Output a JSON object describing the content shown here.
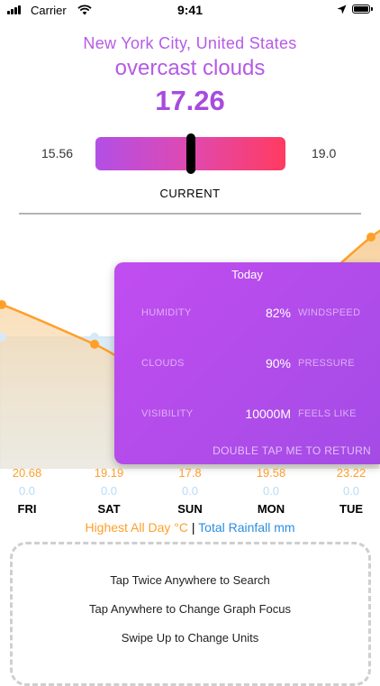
{
  "status_bar": {
    "carrier": "Carrier",
    "time": "9:41"
  },
  "location": {
    "city": "New York City, United States"
  },
  "weather": {
    "description": "overcast clouds",
    "temperature": "17.26"
  },
  "gauge": {
    "min": "15.56",
    "max": "19.0",
    "label": "CURRENT",
    "current_fraction": 0.5
  },
  "details_card": {
    "title": "Today",
    "humidity_label": "HUMIDITY",
    "humidity_value": "82%",
    "windspeed_label": "WINDSPEED",
    "clouds_label": "CLOUDS",
    "clouds_value": "90%",
    "pressure_label": "PRESSURE",
    "visibility_label": "VISIBILITY",
    "visibility_value": "10000M",
    "feels_like_label": "FEELS LIKE",
    "return_hint": "DOUBLE TAP ME TO RETURN"
  },
  "chart_data": {
    "type": "area",
    "categories": [
      "FRI",
      "SAT",
      "SUN",
      "MON",
      "TUE"
    ],
    "series": [
      {
        "name": "Highest All Day °C",
        "values": [
          20.68,
          19.19,
          17.8,
          19.58,
          23.22
        ],
        "color": "#ff9f2a"
      },
      {
        "name": "Total Rainfall mm",
        "values": [
          0.0,
          0.0,
          0.0,
          0.0,
          0.0
        ],
        "color": "#b9dcf5"
      }
    ]
  },
  "forecast": [
    {
      "hi": "20.68",
      "rain": "0.0",
      "day": "FRI"
    },
    {
      "hi": "19.19",
      "rain": "0.0",
      "day": "SAT"
    },
    {
      "hi": "17.8",
      "rain": "0.0",
      "day": "SUN"
    },
    {
      "hi": "19.58",
      "rain": "0.0",
      "day": "MON"
    },
    {
      "hi": "23.22",
      "rain": "0.0",
      "day": "TUE"
    }
  ],
  "legend": {
    "highest": "Highest All Day °C",
    "separator": "|",
    "rainfall": "Total Rainfall mm"
  },
  "help": {
    "line1": "Tap Twice Anywhere to Search",
    "line2": "Tap Anywhere to Change Graph Focus",
    "line3": "Swipe Up to Change Units"
  },
  "colors": {
    "accent": "#b45ae6",
    "temperature": "#ff9f2a",
    "rain": "#2b8de0"
  }
}
